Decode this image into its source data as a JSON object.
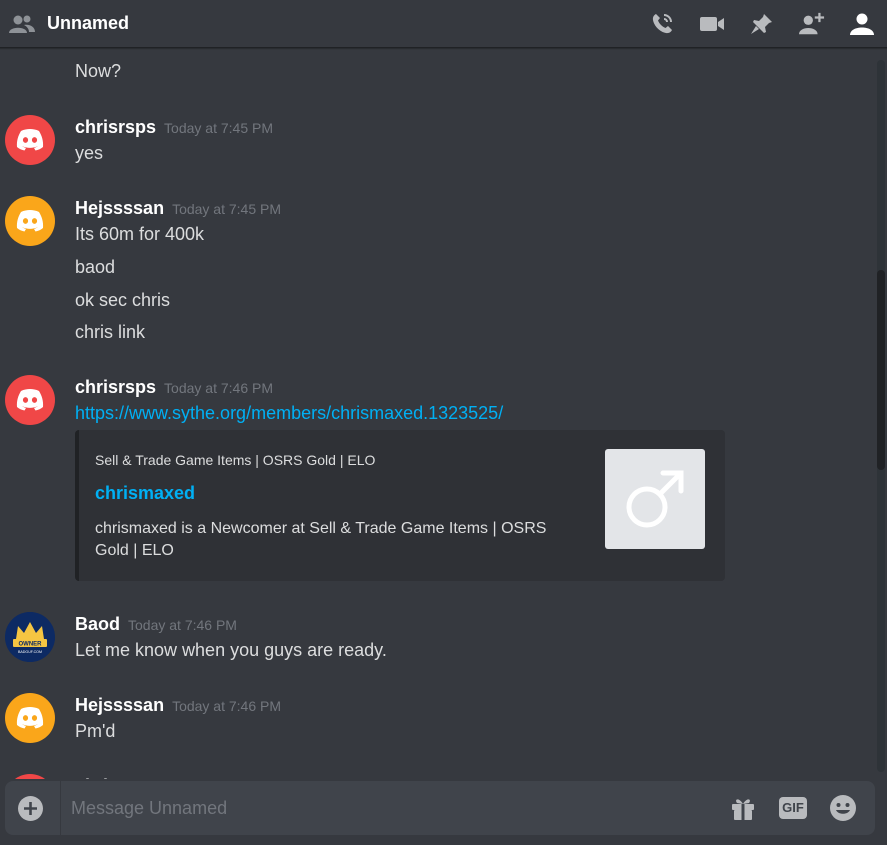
{
  "header": {
    "title": "Unnamed",
    "tools": [
      "start-voice-call-icon",
      "start-video-call-icon",
      "pinned-messages-icon",
      "add-friends-to-dm-icon",
      "member-list-icon"
    ]
  },
  "messages": [
    {
      "continuation": true,
      "lines": [
        "Now?"
      ]
    },
    {
      "username": "chrisrsps",
      "timestamp": "Today at 7:45 PM",
      "avatar": "red",
      "lines": [
        "yes"
      ]
    },
    {
      "username": "Hejssssan",
      "timestamp": "Today at 7:45 PM",
      "avatar": "yellow",
      "lines": [
        "Its 60m for 400k",
        "baod",
        "ok sec chris",
        "chris link"
      ]
    },
    {
      "username": "chrisrsps",
      "timestamp": "Today at 7:46 PM",
      "avatar": "red",
      "link": "https://www.sythe.org/members/chrismaxed.1323525/",
      "embed": {
        "provider": "Sell & Trade Game Items | OSRS Gold | ELO",
        "title": "chrismaxed",
        "description": "chrismaxed is a Newcomer at Sell & Trade Game Items | OSRS Gold | ELO",
        "thumbnail": "male-symbol-icon"
      }
    },
    {
      "username": "Baod",
      "timestamp": "Today at 7:46 PM",
      "avatar": "owner-badge",
      "avatar_text": [
        "OWNER",
        "BADGUF.COM"
      ],
      "lines": [
        "Let me know when you guys are ready."
      ]
    },
    {
      "username": "Hejssssan",
      "timestamp": "Today at 7:46 PM",
      "avatar": "yellow",
      "lines": [
        "Pm'd"
      ]
    },
    {
      "username": "chrisrsps",
      "avatar": "red",
      "partially_hidden": true
    }
  ],
  "composer": {
    "placeholder": "Message Unnamed",
    "gif_label": "GIF"
  },
  "colors": {
    "background": "#36393f",
    "header_border": "#202225",
    "embed_bg": "#2f3136",
    "link": "#00b0f4",
    "avatar_red": "#f04747",
    "avatar_yellow": "#faa61a",
    "timestamp": "#72767d"
  }
}
